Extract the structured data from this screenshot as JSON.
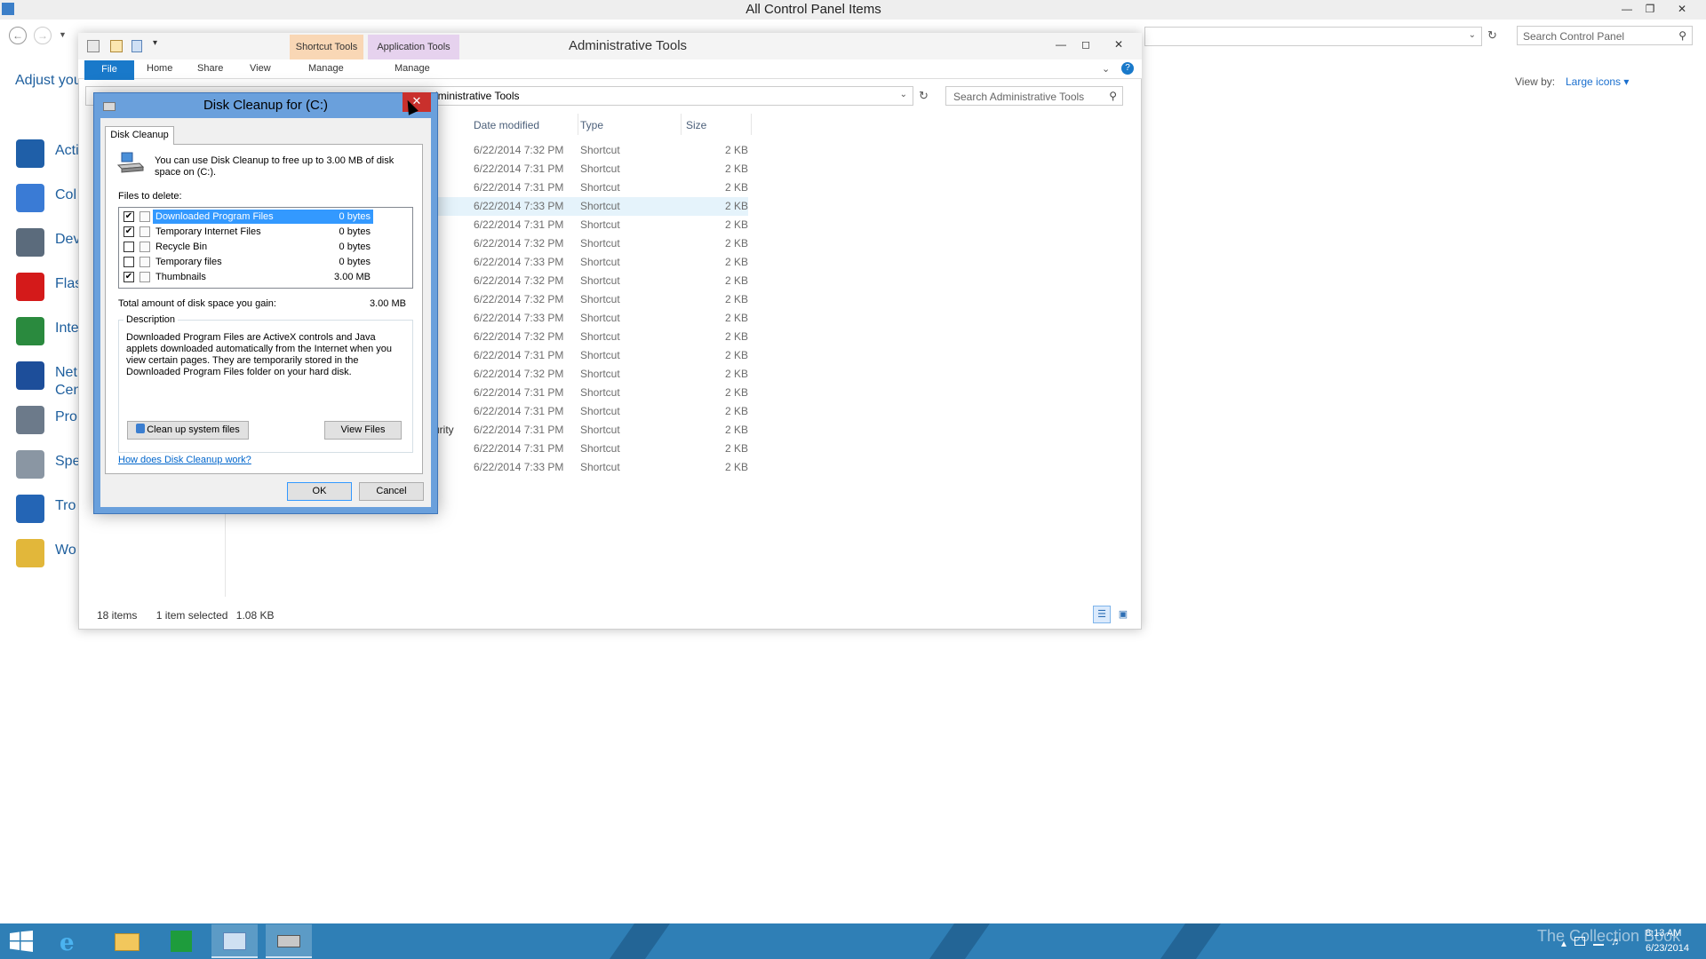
{
  "control_panel": {
    "title": "All Control Panel Items",
    "search_placeholder": "Search Control Panel",
    "heading": "Adjust you",
    "view_by_label": "View by:",
    "view_by_value": "Large icons ▾",
    "items": [
      {
        "label": "Acti",
        "icon": "flag-icon",
        "color": "#1f5fa8"
      },
      {
        "label": "Col",
        "icon": "color-management-icon",
        "color": "#3a7bd5"
      },
      {
        "label": "Dev",
        "icon": "devices-icon",
        "color": "#5b6b7c"
      },
      {
        "label": "Flas",
        "icon": "flash-player-icon",
        "color": "#d41a1a"
      },
      {
        "label": "Inte",
        "icon": "globe-icon",
        "color": "#2a8a3e"
      },
      {
        "label": "Net",
        "label2": "Cen",
        "icon": "network-icon",
        "color": "#1d4e9a"
      },
      {
        "label": "Pro",
        "icon": "programs-icon",
        "color": "#6c7a8a"
      },
      {
        "label": "Spe",
        "icon": "microphone-icon",
        "color": "#8a96a3"
      },
      {
        "label": "Tro",
        "icon": "troubleshoot-icon",
        "color": "#2465b5"
      },
      {
        "label": "Wo",
        "icon": "work-folders-icon",
        "color": "#e2b73a"
      }
    ]
  },
  "explorer": {
    "title": "Administrative Tools",
    "context_tabs": [
      {
        "group": "Shortcut Tools",
        "tab": "Manage",
        "color": "#f9d7b5"
      },
      {
        "group": "Application Tools",
        "tab": "Manage",
        "color": "#e6d2ee"
      }
    ],
    "ribbon_tabs": [
      "File",
      "Home",
      "Share",
      "View"
    ],
    "address": "dministrative Tools",
    "search_placeholder": "Search Administrative Tools",
    "columns": [
      "Date modified",
      "Type",
      "Size"
    ],
    "rows": [
      {
        "date": "6/22/2014 7:32 PM",
        "type": "Shortcut",
        "size": "2 KB"
      },
      {
        "date": "6/22/2014 7:31 PM",
        "type": "Shortcut",
        "size": "2 KB"
      },
      {
        "date": "6/22/2014 7:31 PM",
        "type": "Shortcut",
        "size": "2 KB"
      },
      {
        "date": "6/22/2014 7:33 PM",
        "type": "Shortcut",
        "size": "2 KB",
        "selected": true
      },
      {
        "date": "6/22/2014 7:31 PM",
        "type": "Shortcut",
        "size": "2 KB"
      },
      {
        "date": "6/22/2014 7:32 PM",
        "type": "Shortcut",
        "size": "2 KB"
      },
      {
        "date": "6/22/2014 7:33 PM",
        "type": "Shortcut",
        "size": "2 KB"
      },
      {
        "date": "6/22/2014 7:32 PM",
        "type": "Shortcut",
        "size": "2 KB"
      },
      {
        "date": "6/22/2014 7:32 PM",
        "type": "Shortcut",
        "size": "2 KB"
      },
      {
        "date": "6/22/2014 7:33 PM",
        "type": "Shortcut",
        "size": "2 KB"
      },
      {
        "date": "6/22/2014 7:32 PM",
        "type": "Shortcut",
        "size": "2 KB"
      },
      {
        "date": "6/22/2014 7:31 PM",
        "type": "Shortcut",
        "size": "2 KB"
      },
      {
        "date": "6/22/2014 7:32 PM",
        "type": "Shortcut",
        "size": "2 KB"
      },
      {
        "date": "6/22/2014 7:31 PM",
        "type": "Shortcut",
        "size": "2 KB"
      },
      {
        "date": "6/22/2014 7:31 PM",
        "type": "Shortcut",
        "size": "2 KB"
      },
      {
        "date": "6/22/2014 7:31 PM",
        "type": "Shortcut",
        "size": "2 KB",
        "name_fragment": "urity"
      },
      {
        "date": "6/22/2014 7:31 PM",
        "type": "Shortcut",
        "size": "2 KB"
      },
      {
        "date": "6/22/2014 7:33 PM",
        "type": "Shortcut",
        "size": "2 KB"
      }
    ],
    "status": {
      "count": "18 items",
      "selection": "1 item selected",
      "size": "1.08 KB"
    }
  },
  "dialog": {
    "title": "Disk Cleanup for  (C:)",
    "tab": "Disk Cleanup",
    "intro": "You can use Disk Cleanup to free up to 3.00 MB of disk space on  (C:).",
    "files_label": "Files to delete:",
    "files": [
      {
        "name": "Downloaded Program Files",
        "size": "0 bytes",
        "checked": true,
        "selected": true
      },
      {
        "name": "Temporary Internet Files",
        "size": "0 bytes",
        "checked": true
      },
      {
        "name": "Recycle Bin",
        "size": "0 bytes",
        "checked": false
      },
      {
        "name": "Temporary files",
        "size": "0 bytes",
        "checked": false
      },
      {
        "name": "Thumbnails",
        "size": "3.00 MB",
        "checked": true
      }
    ],
    "total_label": "Total amount of disk space you gain:",
    "total_value": "3.00 MB",
    "description_label": "Description",
    "description": "Downloaded Program Files are ActiveX controls and Java applets downloaded automatically from the Internet when you view certain pages. They are temporarily stored in the Downloaded Program Files folder on your hard disk.",
    "cleanup_button": "Clean up system files",
    "view_files_button": "View Files",
    "help_link": "How does Disk Cleanup work?",
    "ok_button": "OK",
    "cancel_button": "Cancel"
  },
  "taskbar": {
    "watermark": "The Collection Book",
    "time": "8:13 AM",
    "date": "6/23/2014",
    "accent": "#2f7fb6"
  }
}
